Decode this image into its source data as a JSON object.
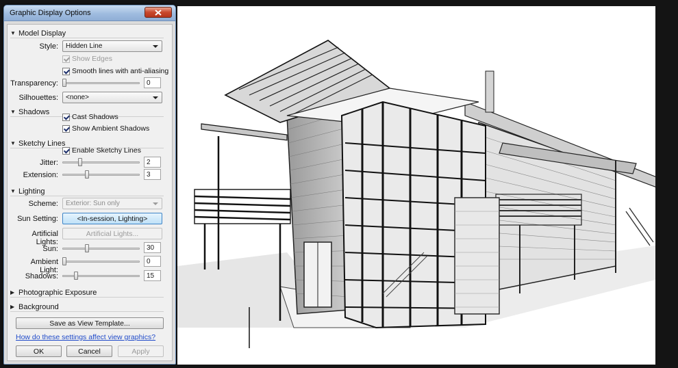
{
  "dialog": {
    "title": "Graphic Display Options",
    "close_icon": "close-icon",
    "sections": {
      "model_display": {
        "label": "Model Display",
        "style_label": "Style:",
        "style_value": "Hidden Line",
        "show_edges": {
          "label": "Show Edges",
          "checked": true,
          "enabled": false
        },
        "smooth_lines": {
          "label": "Smooth lines with anti-aliasing",
          "checked": true
        },
        "transparency_label": "Transparency:",
        "transparency_value": "0",
        "silhouettes_label": "Silhouettes:",
        "silhouettes_value": "<none>"
      },
      "shadows": {
        "label": "Shadows",
        "cast_shadows": {
          "label": "Cast Shadows",
          "checked": true
        },
        "ambient_shadows": {
          "label": "Show Ambient Shadows",
          "checked": true
        }
      },
      "sketchy_lines": {
        "label": "Sketchy Lines",
        "enable": {
          "label": "Enable Sketchy Lines",
          "checked": true
        },
        "jitter_label": "Jitter:",
        "jitter_value": "2",
        "extension_label": "Extension:",
        "extension_value": "3"
      },
      "lighting": {
        "label": "Lighting",
        "scheme_label": "Scheme:",
        "scheme_value": "Exterior: Sun only",
        "sun_setting_label": "Sun Setting:",
        "sun_setting_value": "<In-session, Lighting>",
        "artificial_lights_label": "Artificial Lights:",
        "artificial_lights_button": "Artificial Lights...",
        "sun_label": "Sun:",
        "sun_value": "30",
        "ambient_light_label": "Ambient Light:",
        "ambient_light_value": "0",
        "shadows_label": "Shadows:",
        "shadows_value": "15"
      },
      "photographic_exposure": {
        "label": "Photographic Exposure"
      },
      "background": {
        "label": "Background"
      }
    },
    "save_template_button": "Save as View Template...",
    "help_link": "How do these settings affect view graphics?",
    "ok_button": "OK",
    "cancel_button": "Cancel",
    "apply_button": "Apply"
  },
  "colors": {
    "titlebar": "#9fbcdf",
    "close_button": "#c8482c",
    "link": "#1f4ac9",
    "highlight_button": "#bfe1f8"
  }
}
